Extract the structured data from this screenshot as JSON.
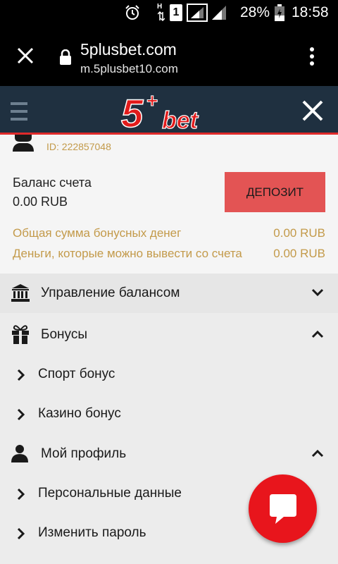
{
  "status_bar": {
    "network_label": "H",
    "sim_label": "1",
    "battery_percent": "28%",
    "time": "18:58",
    "icons": [
      "alarm-icon",
      "data-arrows-icon",
      "sim-icon",
      "signal-icon",
      "signal-icon",
      "battery-charging-icon"
    ]
  },
  "browser": {
    "title": "5plusbet.com",
    "url": "m.5plusbet10.com",
    "icons": [
      "close-icon",
      "lock-icon",
      "more-vert-icon"
    ]
  },
  "site_header": {
    "logo_text": "5+bet",
    "icons": [
      "hamburger-icon",
      "close-icon"
    ],
    "colors": {
      "background": "#1f3040",
      "accent": "#e02a2a"
    }
  },
  "account": {
    "user_id": "ID: 222857048",
    "balance_label": "Баланс счета",
    "balance_value": "0.00 RUB",
    "deposit_label": "ДЕПОЗИТ",
    "bonus_total_label": "Общая сумма бонусных денег",
    "bonus_total_value": "0.00 RUB",
    "withdrawable_label": "Деньги, которые можно вывести со счета",
    "withdrawable_value": "0.00 RUB",
    "colors": {
      "gold": "#c39a4a",
      "deposit": "#e35454"
    }
  },
  "menu": {
    "balance_management": {
      "label": "Управление балансом",
      "icon": "bank-icon",
      "expanded": false
    },
    "bonuses": {
      "label": "Бонусы",
      "icon": "gift-icon",
      "expanded": true,
      "items": [
        {
          "label": "Спорт бонус"
        },
        {
          "label": "Казино бонус"
        }
      ]
    },
    "profile": {
      "label": "Мой профиль",
      "icon": "person-icon",
      "expanded": true,
      "items": [
        {
          "label": "Персональные данные"
        },
        {
          "label": "Изменить пароль"
        }
      ]
    }
  },
  "chat": {
    "icon": "chat-bubble-icon",
    "color": "#e8151c"
  }
}
